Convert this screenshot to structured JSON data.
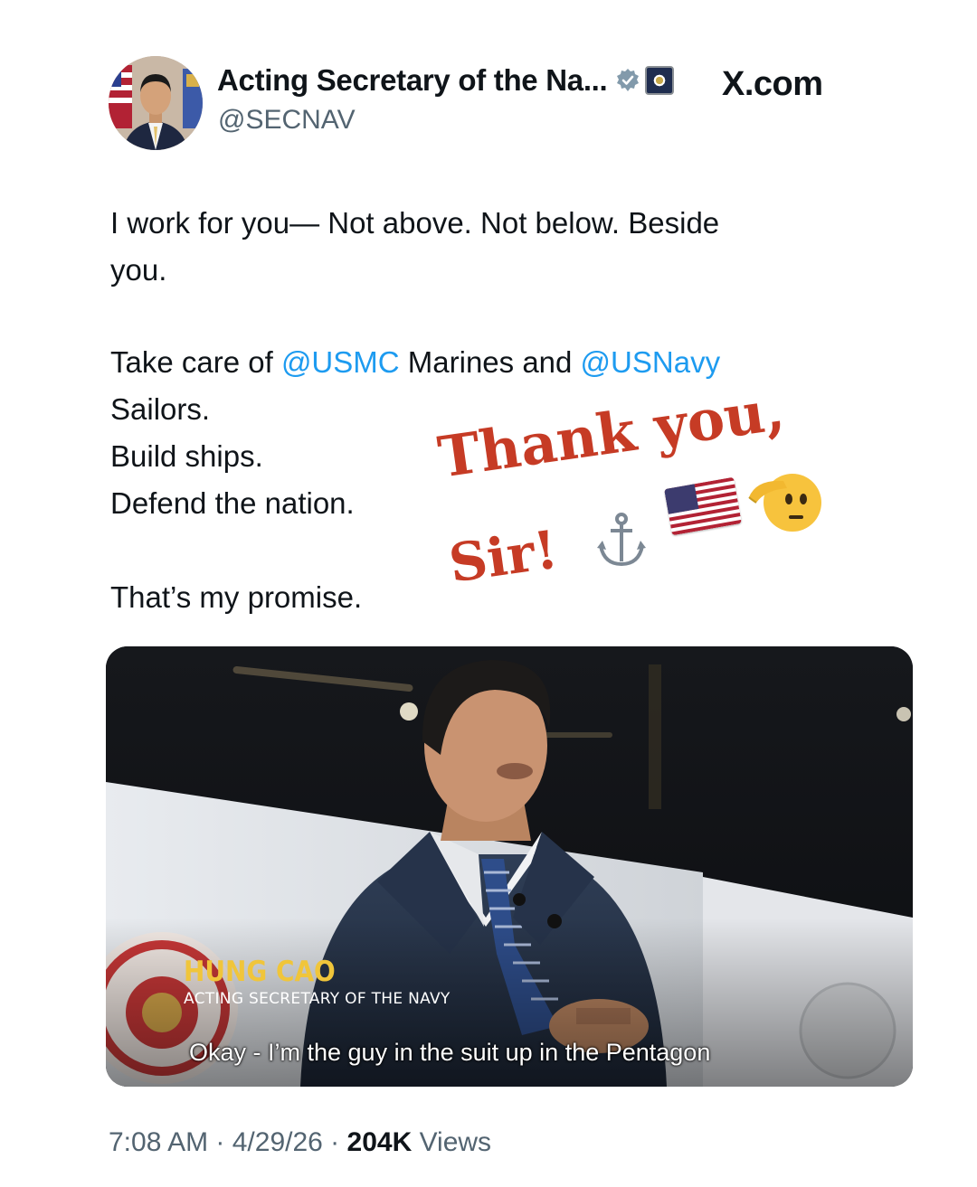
{
  "header": {
    "display_name": "Acting Secretary of the Na...",
    "handle": "@SECNAV",
    "site": "X.com",
    "verified_icon": "verified-badge-icon",
    "affiliation_icon": "dod-seal-icon"
  },
  "tweet": {
    "line1": "I work for you— Not above. Not below. Beside",
    "line2": "you.",
    "line3_prefix": "Take care of ",
    "mention_usmc": "@USMC",
    "line3_middle": " Marines and ",
    "mention_usnavy": "@USNavy",
    "line4": "Sailors.",
    "line5": "Build ships.",
    "line6": "Defend the nation.",
    "line7": "That’s my promise."
  },
  "sticker": {
    "line1": "Thank you,",
    "line2": "Sir!",
    "emojis": [
      "anchor-icon",
      "us-flag-icon",
      "saluting-face-icon"
    ]
  },
  "media": {
    "lower_third_name": "HUNG CAO",
    "lower_third_title": "ACTING SECRETARY OF THE NAVY",
    "caption": "Okay - I’m the guy in the suit up in the Pentagon"
  },
  "meta": {
    "time": "7:08 AM",
    "sep1": " · ",
    "date": "4/29/26",
    "sep2": " · ",
    "views_count": "204K",
    "views_label": " Views"
  },
  "colors": {
    "link": "#1d9bf0",
    "secondary_text": "#536471",
    "sticker_red": "#c63b25",
    "lower_third_gold": "#f0c53a"
  }
}
